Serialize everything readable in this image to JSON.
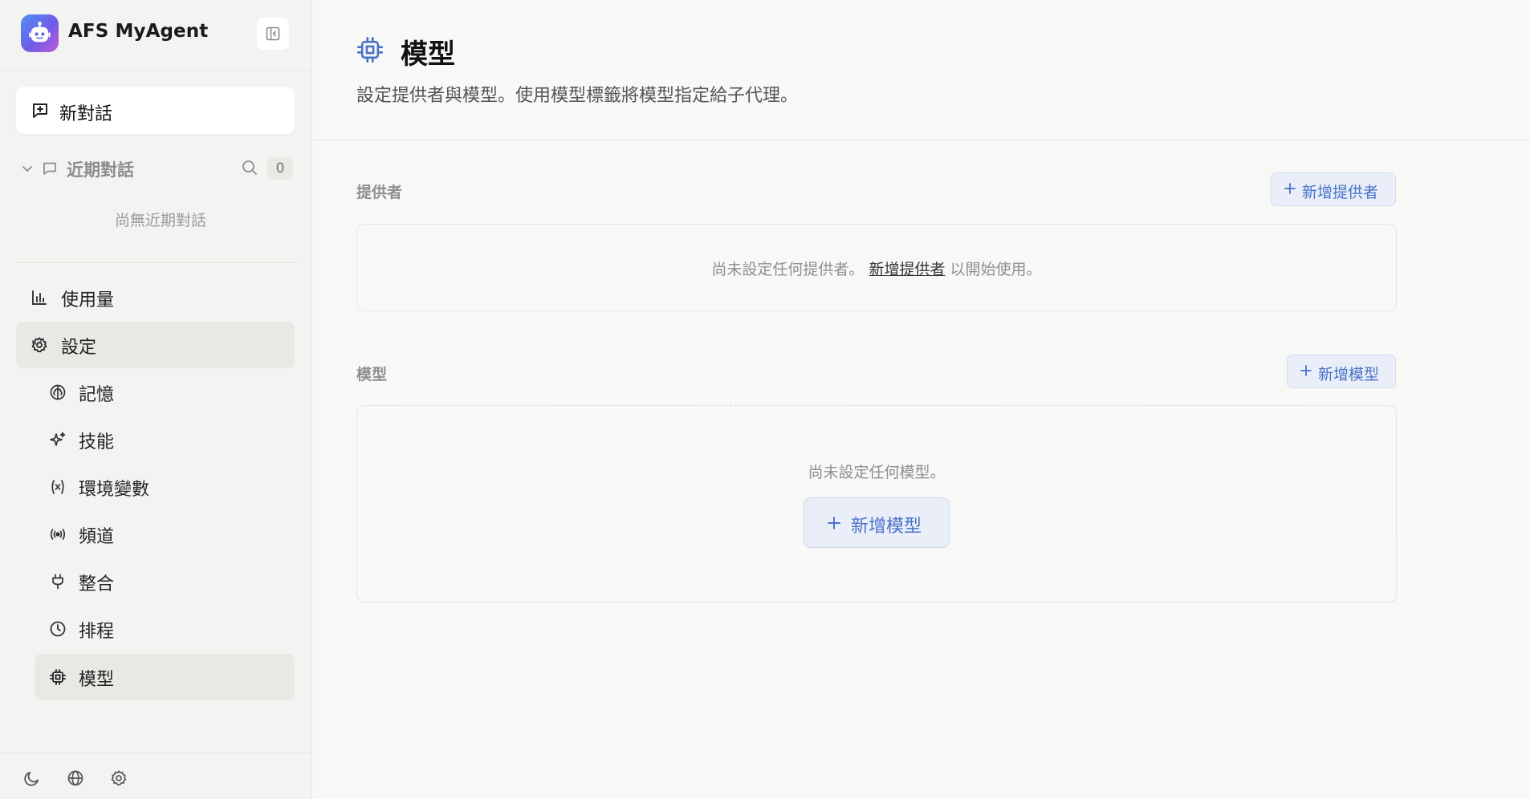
{
  "app": {
    "name": "AFS MyAgent"
  },
  "sidebar": {
    "new_chat_label": "新對話",
    "recent": {
      "title": "近期對話",
      "count": "0",
      "empty_text": "尚無近期對話"
    },
    "nav": {
      "usage": "使用量",
      "settings": "設定",
      "sub": {
        "memory": "記憶",
        "skills": "技能",
        "env_vars": "環境變數",
        "channels": "頻道",
        "integrations": "整合",
        "schedule": "排程",
        "models": "模型"
      }
    }
  },
  "page": {
    "title": "模型",
    "description": "設定提供者與模型。使用模型標籤將模型指定給子代理。"
  },
  "providers": {
    "section_label": "提供者",
    "add_label": "新增提供者",
    "empty_prefix": "尚未設定任何提供者。",
    "empty_link": "新增提供者",
    "empty_suffix": "以開始使用。"
  },
  "models": {
    "section_label": "模型",
    "add_label": "新增模型",
    "empty_text": "尚未設定任何模型。",
    "empty_add_label": "新增模型"
  },
  "colors": {
    "accent": "#4a72c9",
    "accent_bg": "#e9eef8",
    "sidebar_bg": "#f3f3f1",
    "main_bg": "#f8f8f6"
  },
  "icons": {
    "logo": "robot-icon",
    "collapse": "sidebar-collapse-icon",
    "new_chat": "message-plus-icon",
    "recent_toggle": "chevron-down-icon",
    "recent": "message-icon",
    "search": "search-icon",
    "usage": "bar-chart-icon",
    "settings": "gear-icon",
    "memory": "brain-icon",
    "skills": "sparkle-icon",
    "env_vars": "variable-icon",
    "channels": "radio-icon",
    "integrations": "plug-icon",
    "schedule": "clock-icon",
    "models": "chip-icon",
    "theme": "moon-icon",
    "language": "globe-icon",
    "preferences": "gear-icon"
  }
}
